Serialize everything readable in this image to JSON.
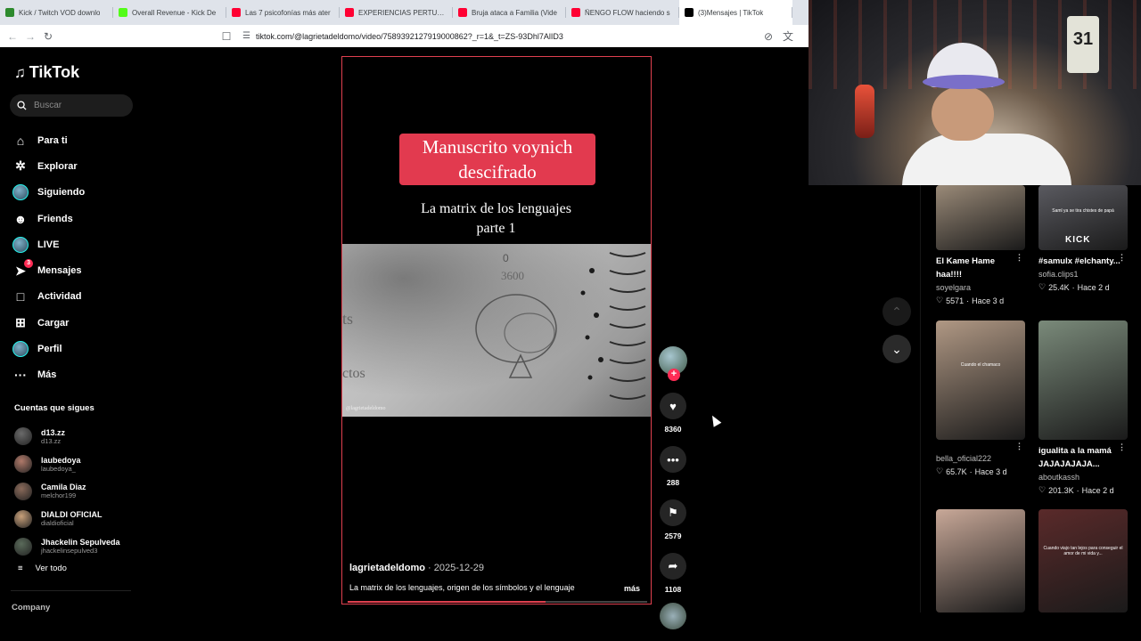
{
  "tabs": [
    {
      "label": "Kick / Twitch VOD downlo",
      "color": "#2d8a2d"
    },
    {
      "label": "Overall Revenue - Kick De",
      "color": "#53fc18"
    },
    {
      "label": "Las 7 psicofonías más ater",
      "color": "#ff0033"
    },
    {
      "label": "EXPERIENCIAS PERTURBA",
      "color": "#ff0033"
    },
    {
      "label": "Bruja ataca a Familia (Vide",
      "color": "#ff0033"
    },
    {
      "label": "ÑENGO FLOW haciendo s",
      "color": "#ff0033"
    },
    {
      "label": "(3)Mensajes | TikTok",
      "color": "#000000"
    }
  ],
  "url": "tiktok.com/@lagrietadeldomo/video/7589392127919000862?_r=1&_t=ZS-93Dhl7AlID3",
  "sidebar": {
    "logo": "TikTok",
    "search_placeholder": "Buscar",
    "nav": [
      {
        "label": "Para ti",
        "icon": "home-icon"
      },
      {
        "label": "Explorar",
        "icon": "compass-icon"
      },
      {
        "label": "Siguiendo",
        "icon": "following-avatar-icon"
      },
      {
        "label": "Friends",
        "icon": "friends-icon"
      },
      {
        "label": "LIVE",
        "icon": "live-avatar-icon"
      },
      {
        "label": "Mensajes",
        "icon": "messages-icon",
        "badge": "3"
      },
      {
        "label": "Actividad",
        "icon": "activity-icon"
      },
      {
        "label": "Cargar",
        "icon": "upload-icon"
      },
      {
        "label": "Perfil",
        "icon": "profile-avatar-icon"
      },
      {
        "label": "Más",
        "icon": "more-icon"
      }
    ],
    "following_title": "Cuentas que sigues",
    "following": [
      {
        "name": "d13.zz",
        "user": "d13.zz",
        "color": "#6a6a6a"
      },
      {
        "name": "laubedoya",
        "user": "laubedoya_",
        "color": "#b07a6a"
      },
      {
        "name": "Camila Diaz",
        "user": "melchor199",
        "color": "#8a6a5a"
      },
      {
        "name": "DIALDI OFICIAL",
        "user": "dialdioficial",
        "color": "#c8a07a"
      },
      {
        "name": "Jhackelin Sepulveda",
        "user": "jhackelinsepulved3",
        "color": "#5a6a5a"
      }
    ],
    "see_all": "Ver todo",
    "company": "Company"
  },
  "video": {
    "title_line1": "Manuscrito voynich",
    "title_line2": "descifrado",
    "subtitle_line1": "La matrix de los lenguajes",
    "subtitle_line2": "parte 1",
    "photo_text": "3600",
    "photo_watermark": "@lagrietadeldomo",
    "author": "lagrietadeldomo",
    "date": "2025-12-29",
    "description": "La matrix de los lenguajes, origen de los símbolos y el lenguaje",
    "more": "más",
    "progress": 0.66
  },
  "actions": {
    "likes": "8360",
    "comments": "288",
    "saves": "2579",
    "shares": "1108"
  },
  "recommendations": [
    {
      "title": "El Kame Hame haa!!!!",
      "author": "soyelgara",
      "likes": "5571",
      "age": "Hace 3 d",
      "thumb_color": "#9a8a78"
    },
    {
      "title": "#samulx #elchanty...",
      "author": "sofia.clips1",
      "likes": "25.4K",
      "age": "Hace 2 d",
      "thumb_color": "#5a5a60",
      "thumb_caption": "Saml ya se tira chistes de papá",
      "thumb_brand": "KICK"
    },
    {
      "title": "",
      "author": "bella_oficial222",
      "likes": "65.7K",
      "age": "Hace 3 d",
      "thumb_color": "#b09884",
      "thumb_caption": "Cuando el chamaco"
    },
    {
      "title": "igualita a la mamá JAJAJAJAJA...",
      "author": "aboutkassh",
      "likes": "201.3K",
      "age": "Hace 2 d",
      "thumb_color": "#7a8a7a"
    },
    {
      "title": "",
      "author": "",
      "likes": "",
      "age": "",
      "thumb_color": "#c8a898"
    },
    {
      "title": "",
      "author": "",
      "likes": "",
      "age": "",
      "thumb_color": "#5a2a2a",
      "thumb_caption": "Cuando viajo tan lejos para conseguir el amor de mi vida y..."
    }
  ]
}
